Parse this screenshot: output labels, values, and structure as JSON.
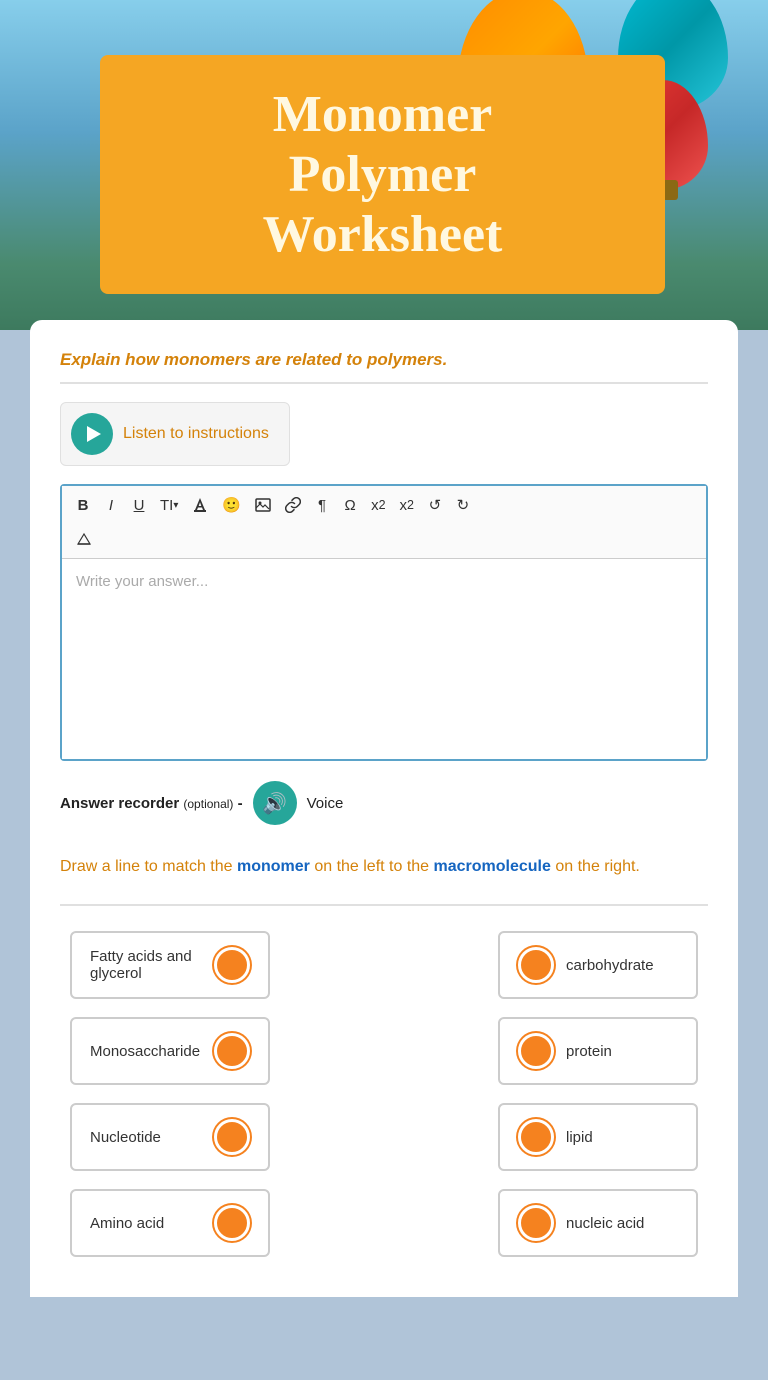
{
  "hero": {
    "title_line1": "Monomer",
    "title_line2": "Polymer",
    "title_line3": "Worksheet"
  },
  "question1": {
    "text": "Explain how monomers are related to polymers."
  },
  "listen_btn": {
    "label": "Listen to instructions"
  },
  "toolbar": {
    "bold": "B",
    "italic": "I",
    "underline": "U",
    "font_size": "TI▾",
    "color": "🖍",
    "emoji": "🙂",
    "image": "🖼",
    "link": "🔗",
    "paragraph": "¶",
    "omega": "Ω",
    "subscript": "x₂",
    "superscript": "x²",
    "undo": "↺",
    "redo": "↻",
    "erase": "✏"
  },
  "editor": {
    "placeholder": "Write your answer..."
  },
  "recorder": {
    "label": "Answer recorder",
    "optional_label": "(optional)",
    "dash": "-",
    "voice_label": "Voice"
  },
  "question2": {
    "text_before": "Draw a line to match the ",
    "monomer_word": "monomer",
    "text_middle": " on the left to the ",
    "macro_word": "macromolecule",
    "text_after": " on the right."
  },
  "matching": {
    "left_items": [
      "Fatty acids and glycerol",
      "Monosaccharide",
      "Nucleotide",
      "Amino acid"
    ],
    "right_items": [
      "carbohydrate",
      "protein",
      "lipid",
      "nucleic acid"
    ]
  }
}
